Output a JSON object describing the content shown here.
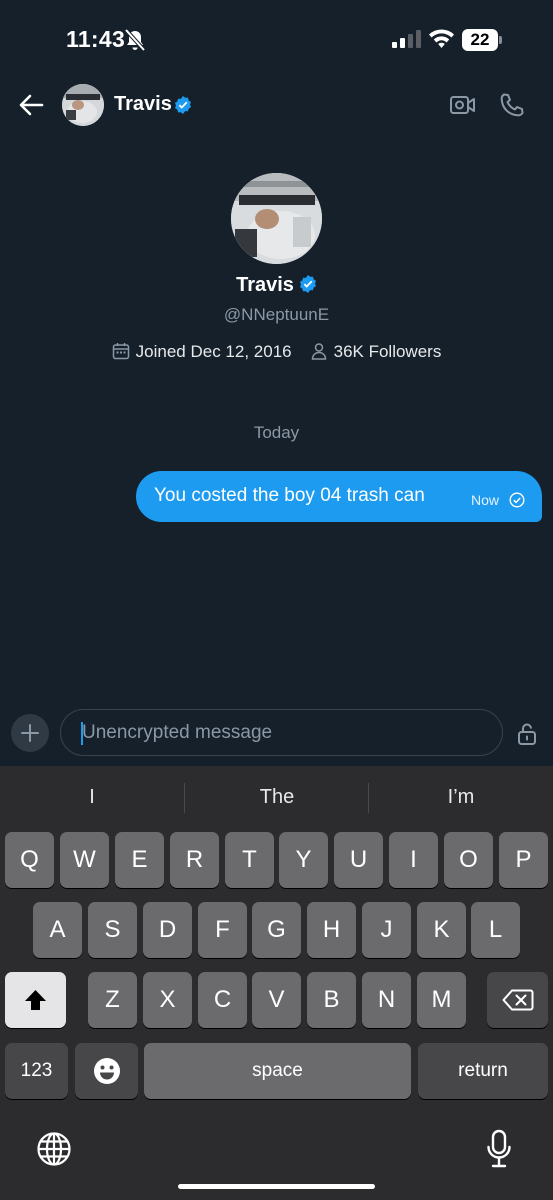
{
  "status_bar": {
    "time": "11:43",
    "battery": "22"
  },
  "header": {
    "name": "Travis"
  },
  "profile": {
    "name": "Travis",
    "handle": "@NNeptuunE",
    "joined": "Joined Dec 12, 2016",
    "followers": "36K Followers"
  },
  "conversation": {
    "date_separator": "Today",
    "messages": [
      {
        "text": "You costed the boy 04 trash can",
        "time": "Now",
        "status": "sent"
      }
    ]
  },
  "composer": {
    "placeholder": "Unencrypted message"
  },
  "keyboard": {
    "suggestions": [
      "I",
      "The",
      "I’m"
    ],
    "row1": [
      "Q",
      "W",
      "E",
      "R",
      "T",
      "Y",
      "U",
      "I",
      "O",
      "P"
    ],
    "row2": [
      "A",
      "S",
      "D",
      "F",
      "G",
      "H",
      "J",
      "K",
      "L"
    ],
    "row3": [
      "Z",
      "X",
      "C",
      "V",
      "B",
      "N",
      "M"
    ],
    "numbers_label": "123",
    "space_label": "space",
    "return_label": "return"
  },
  "colors": {
    "accent": "#1d9bf0",
    "background": "#15202b",
    "keyboard": "#2c2c2e"
  }
}
